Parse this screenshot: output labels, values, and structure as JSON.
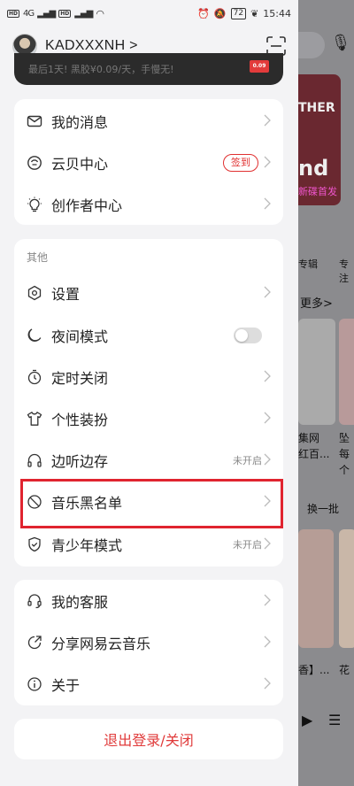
{
  "status_bar": {
    "signal_1": "4G",
    "battery": "72",
    "time": "15:44"
  },
  "header": {
    "username": "KADXXXNH >"
  },
  "vip_banner": {
    "text": "最后1天! 黑胶¥0.09/天，手慢无!",
    "badge": "0.09"
  },
  "account_menu": {
    "items": [
      {
        "label": "我的消息"
      },
      {
        "label": "云贝中心",
        "badge": "签到"
      },
      {
        "label": "创作者中心"
      }
    ]
  },
  "other_menu": {
    "section_title": "其他",
    "items": [
      {
        "label": "设置"
      },
      {
        "label": "夜间模式",
        "toggle": false
      },
      {
        "label": "定时关闭"
      },
      {
        "label": "个性装扮"
      },
      {
        "label": "边听边存",
        "meta": "未开启"
      },
      {
        "label": "音乐黑名单"
      },
      {
        "label": "青少年模式",
        "meta": "未开启"
      }
    ]
  },
  "service_menu": {
    "items": [
      {
        "label": "我的客服"
      },
      {
        "label": "分享网易云音乐"
      },
      {
        "label": "关于"
      }
    ]
  },
  "logout": {
    "label": "退出登录/关闭"
  },
  "background_page": {
    "banner_word": "THER",
    "banner_big": "nd",
    "banner_sub": "新碟首发",
    "cat1": "专辑",
    "cat2": "专注",
    "more": "更多>",
    "cap1a": "集网",
    "cap1b": "红百...",
    "cap2a": "坠",
    "cap2b": "每个",
    "refresh": "换一批",
    "cap3": "香】...",
    "cap4": "花"
  },
  "colors": {
    "accent": "#e03a3a",
    "highlight": "#e0242f"
  }
}
